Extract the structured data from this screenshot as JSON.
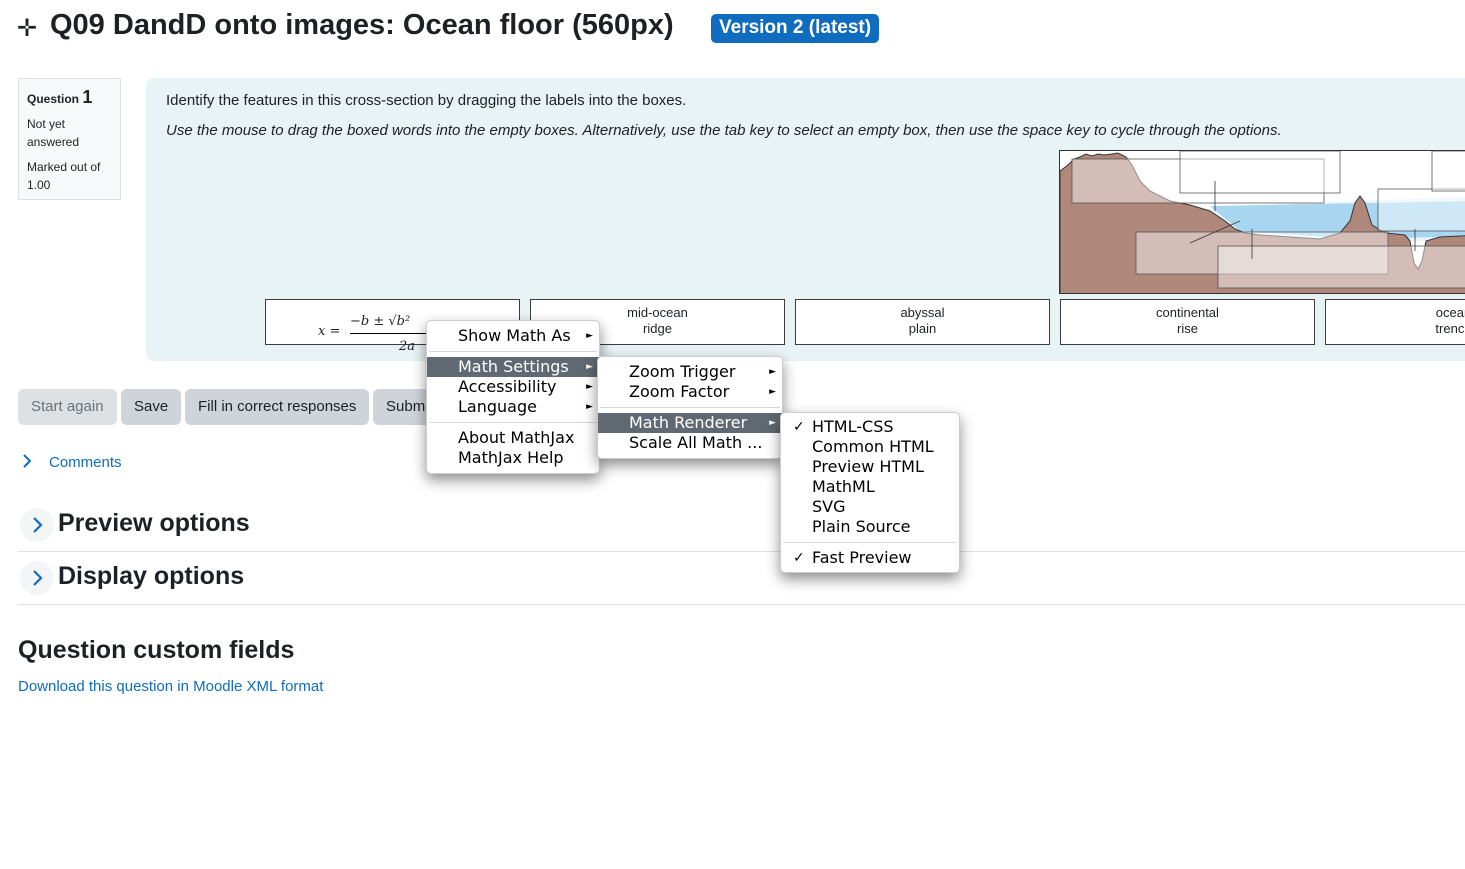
{
  "header": {
    "icon": "move-icon",
    "title": "Q09 DandD onto images: Ocean floor (560px)",
    "badge": "Version 2 (latest)"
  },
  "question_info": {
    "label": "Question",
    "number": "1",
    "status": "Not yet answered",
    "marks": "Marked out of 1.00"
  },
  "question": {
    "text": "Identify the features in this cross-section by dragging the labels into the boxes.",
    "hint": "Use the mouse to drag the boxed words into the empty boxes. Alternatively, use the tab key to select an empty box, then use the space key to cycle through the options."
  },
  "drag_items": [
    {
      "line1": "mid-ocean",
      "line2": "ridge"
    },
    {
      "line1": "abyssal",
      "line2": "plain"
    },
    {
      "line1": "continental",
      "line2": "rise"
    },
    {
      "line1": "ocean",
      "line2": "trench"
    }
  ],
  "formula": {
    "lhs": "x =",
    "numerator": "−b ± √b²",
    "denominator": "2a"
  },
  "buttons": {
    "start_again": "Start again",
    "save": "Save",
    "fill_correct": "Fill in correct responses",
    "submit": "Submit and finish"
  },
  "comments_link": "Comments",
  "sections": {
    "preview": "Preview options",
    "display": "Display options",
    "custom_fields": "Question custom fields"
  },
  "download_link": "Download this question in Moodle XML format",
  "mathjax_menu": {
    "main": {
      "show_math_as": "Show Math As",
      "math_settings": "Math Settings",
      "accessibility": "Accessibility",
      "language": "Language",
      "about": "About MathJax",
      "help": "MathJax Help"
    },
    "settings": {
      "zoom_trigger": "Zoom Trigger",
      "zoom_factor": "Zoom Factor",
      "math_renderer": "Math Renderer",
      "scale_all": "Scale All Math ..."
    },
    "renderer": {
      "options": [
        "HTML-CSS",
        "Common HTML",
        "Preview HTML",
        "MathML",
        "SVG",
        "Plain Source"
      ],
      "selected": "HTML-CSS",
      "fast_preview": "Fast Preview",
      "check_mark": "✓"
    }
  },
  "colors": {
    "accent": "#0f6cbf",
    "question_bg": "#e7f3f5",
    "menu_highlight": "#606872"
  }
}
